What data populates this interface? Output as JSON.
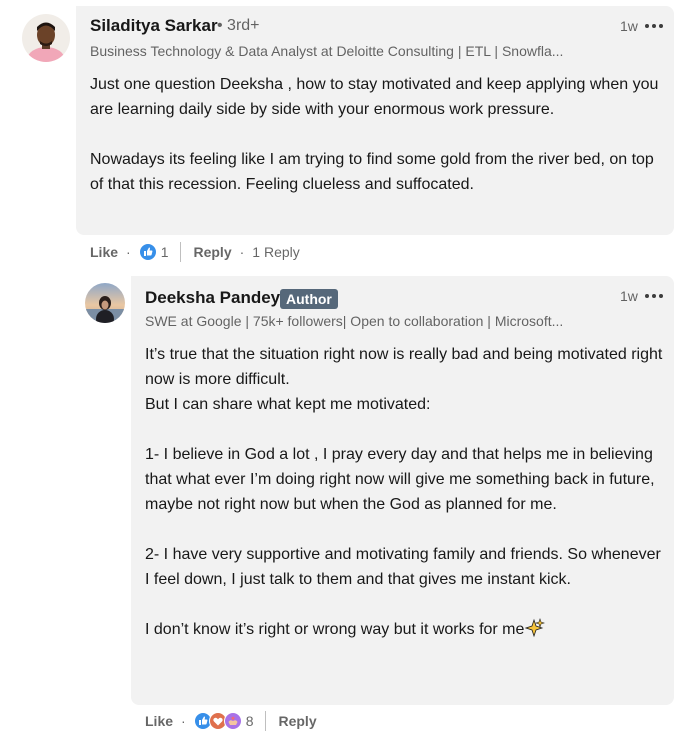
{
  "comment": {
    "author": "Siladitya Sarkar",
    "degree": "• 3rd+",
    "headline": "Business Technology & Data Analyst at Deloitte Consulting | ETL | Snowfla...",
    "time": "1w",
    "paragraphs": [
      "Just one question Deeksha , how to stay motivated and keep applying when you are learning daily side by side with your enormous work pressure.",
      "",
      "Nowadays its feeling like I am trying to find some gold from the river bed, on top of that this recession. Feeling clueless and suffocated."
    ],
    "actions": {
      "like_label": "Like",
      "reaction_count": "1",
      "reply_label": "Reply",
      "replies_count": "1 Reply"
    }
  },
  "reply": {
    "author": "Deeksha Pandey",
    "badge": "Author",
    "headline": "SWE at Google | 75k+ followers| Open to collaboration | Microsoft...",
    "time": "1w",
    "paragraphs": [
      "It’s true that the situation right now is really bad and being motivated right now is more difficult.",
      "But I can share what kept me motivated:",
      "",
      "1- I believe in God a lot , I pray every day and that helps me in believing that what ever I’m doing right now will give me something back in future, maybe not right now but when the God as planned for me.",
      "",
      "2- I have very supportive and motivating family and friends. So whenever I feel down, I just talk to them and that gives me instant kick.",
      "",
      "I don’t know it’s right or wrong way but it works for me"
    ],
    "actions": {
      "like_label": "Like",
      "reaction_count": "8",
      "reply_label": "Reply"
    }
  },
  "colors": {
    "bubble": "#f2f2f2",
    "like_blue": "#378fe9",
    "love_red": "#df704d",
    "support_purple": "#a872e8",
    "badge": "#56687a"
  },
  "icons": {
    "like_reaction": "thumbs-up-icon",
    "love_reaction": "heart-icon",
    "support_reaction": "support-hands-icon",
    "overflow": "ellipsis-icon",
    "sparkles": "sparkles-emoji"
  }
}
